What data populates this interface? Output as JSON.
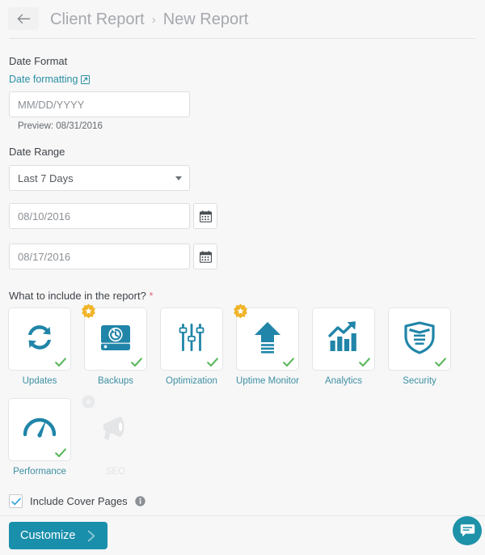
{
  "header": {
    "back_icon": "arrow-left-icon",
    "breadcrumb": {
      "parent": "Client Report",
      "separator": "›",
      "current": "New Report"
    }
  },
  "form": {
    "date_format": {
      "label": "Date Format",
      "link_text": "Date formatting",
      "link_icon": "external-link-icon",
      "input_value": "MM/DD/YYYY",
      "input_placeholder": "MM/DD/YYYY",
      "preview_text": "Preview: 08/31/2016"
    },
    "date_range": {
      "label": "Date Range",
      "selected_option": "Last 7 Days",
      "options": [
        "Last 7 Days"
      ],
      "start_date": "08/10/2016",
      "end_date": "08/17/2016",
      "calendar_icon": "calendar-icon"
    }
  },
  "include_section": {
    "label": "What to include in the report?",
    "required_marker": "*",
    "tiles": [
      {
        "label": "Updates",
        "icon": "refresh-sync-icon",
        "checked": true,
        "badge": false,
        "disabled": false
      },
      {
        "label": "Backups",
        "icon": "backup-drive-icon",
        "checked": true,
        "badge": true,
        "disabled": false
      },
      {
        "label": "Optimization",
        "icon": "sliders-icon",
        "checked": true,
        "badge": false,
        "disabled": false
      },
      {
        "label": "Uptime Monitor",
        "icon": "up-arrow-icon",
        "checked": true,
        "badge": true,
        "disabled": false
      },
      {
        "label": "Analytics",
        "icon": "bar-chart-trend-icon",
        "checked": true,
        "badge": false,
        "disabled": false
      },
      {
        "label": "Security",
        "icon": "shield-icon",
        "checked": true,
        "badge": false,
        "disabled": false
      },
      {
        "label": "Performance",
        "icon": "gauge-icon",
        "checked": true,
        "badge": false,
        "disabled": false
      },
      {
        "label": "SEO",
        "icon": "megaphone-icon",
        "checked": false,
        "badge": true,
        "disabled": true
      }
    ]
  },
  "footer": {
    "cover_pages_label": "Include Cover Pages",
    "cover_pages_checked": true,
    "info_icon": "info-icon",
    "submit_label": "Customize",
    "submit_chevron": "chevron-right-icon",
    "chat_icon": "chat-bubble-icon"
  },
  "colors": {
    "accent_teal": "#1a8fab",
    "icon_teal": "#2085a8",
    "link_teal": "#2a8fa3",
    "label_teal": "#3d8fa1",
    "check_green": "#5cb85c",
    "badge_gold": "#f0b429",
    "required_red": "#e0697a",
    "page_bg": "#f7f7f8",
    "disabled_grey": "#e2e3e4"
  }
}
